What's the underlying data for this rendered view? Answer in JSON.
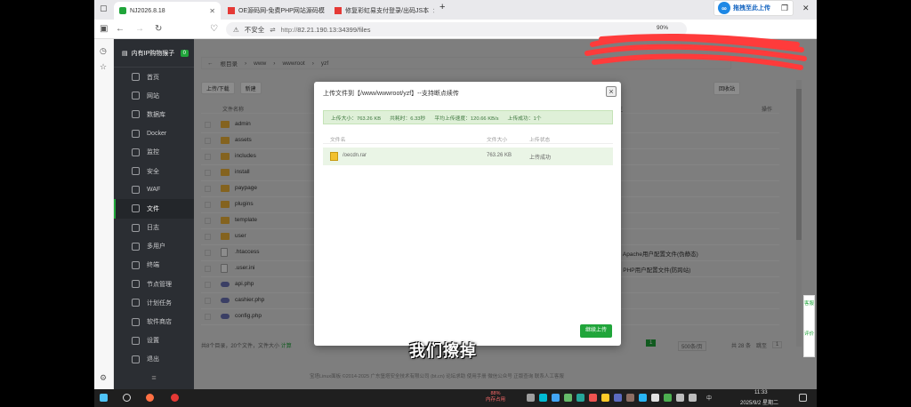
{
  "browser": {
    "tabs": [
      {
        "label": "NJ2026.8.18"
      },
      {
        "label": "OE源码网-免费PHP网站源码模"
      },
      {
        "label": "修复彩虹易支付登录/出码JS本"
      }
    ],
    "new_tab": "+",
    "extension_label": "拖拽至此上传",
    "url_security": "不安全",
    "url_host": "http://",
    "url_path": "82.21.190.13:34399/files",
    "zoom": "90%"
  },
  "sidebar": {
    "server_name": "内有IP购物猴子",
    "count": "0",
    "items": [
      {
        "label": "首页"
      },
      {
        "label": "网站"
      },
      {
        "label": "数据库"
      },
      {
        "label": "Docker"
      },
      {
        "label": "监控"
      },
      {
        "label": "安全"
      },
      {
        "label": "WAF"
      },
      {
        "label": "文件"
      },
      {
        "label": "日志"
      },
      {
        "label": "多用户"
      },
      {
        "label": "终端"
      },
      {
        "label": "节点管理"
      },
      {
        "label": "计划任务"
      },
      {
        "label": "软件商店"
      },
      {
        "label": "设置"
      },
      {
        "label": "退出"
      }
    ]
  },
  "files": {
    "breadcrumb": [
      "根目录",
      "www",
      "wwwroot",
      "yzf"
    ],
    "toolbar": {
      "upload": "上传/下载",
      "new": "新建",
      "recycle": "回收站"
    },
    "header": {
      "name": "文件名称",
      "remark": "备注",
      "ops": "操作"
    },
    "rows": [
      {
        "name": "admin",
        "kind": "dir",
        "remark": ""
      },
      {
        "name": "assets",
        "kind": "dir",
        "remark": ""
      },
      {
        "name": "includes",
        "kind": "dir",
        "remark": ""
      },
      {
        "name": "install",
        "kind": "dir",
        "remark": ""
      },
      {
        "name": "paypage",
        "kind": "dir",
        "remark": ""
      },
      {
        "name": "plugins",
        "kind": "dir",
        "remark": ""
      },
      {
        "name": "template",
        "kind": "dir",
        "remark": ""
      },
      {
        "name": "user",
        "kind": "dir",
        "remark": ""
      },
      {
        "name": ".htaccess",
        "kind": "file",
        "remark": "PS: Apache用户配置文件(伪静态)"
      },
      {
        "name": ".user.ini",
        "kind": "file",
        "remark": "PS: PHP用户配置文件(防跨站)"
      },
      {
        "name": "api.php",
        "kind": "php",
        "remark": ""
      },
      {
        "name": "cashier.php",
        "kind": "php",
        "remark": ""
      },
      {
        "name": "config.php",
        "kind": "php",
        "remark": ""
      }
    ],
    "summary": "共8个目录，20个文件，文件大小",
    "summary_link": "计算",
    "page": "1",
    "per_page": "500条/页",
    "total": "共 28 条",
    "jump_label": "跳至",
    "jump_value": "1",
    "footer": "宝塔Linux面板 ©2014-2025 广东堡塔安全技术有限公司 (bt.cn)   论坛求助   使用手册   微信公众号   正版查询   联系人工客服"
  },
  "dialog": {
    "title": "上传文件到【/www/wwwroot/yzf】--支持断点续传",
    "close": "×",
    "summary": {
      "size": "上传大小：763.26 KB",
      "time": "共耗时：6.33秒",
      "speed": "平均上传速度：120.66 KB/s",
      "ok": "上传成功：1个"
    },
    "cols": {
      "name": "文件名",
      "size": "文件大小",
      "status": "上传状态"
    },
    "file": {
      "name": "/oecdn.rar",
      "size": "763.26 KB",
      "status": "上传成功"
    },
    "continue_button": "继续上传"
  },
  "overlay_subtitle": "我们擦掉",
  "float_panel": {
    "a": "客服",
    "b": "评价"
  },
  "taskbar": {
    "cpu": "88%",
    "cpu_label": "内存占用",
    "ime": "中",
    "time": "11:33",
    "date": "2025/9/2 星期二"
  }
}
